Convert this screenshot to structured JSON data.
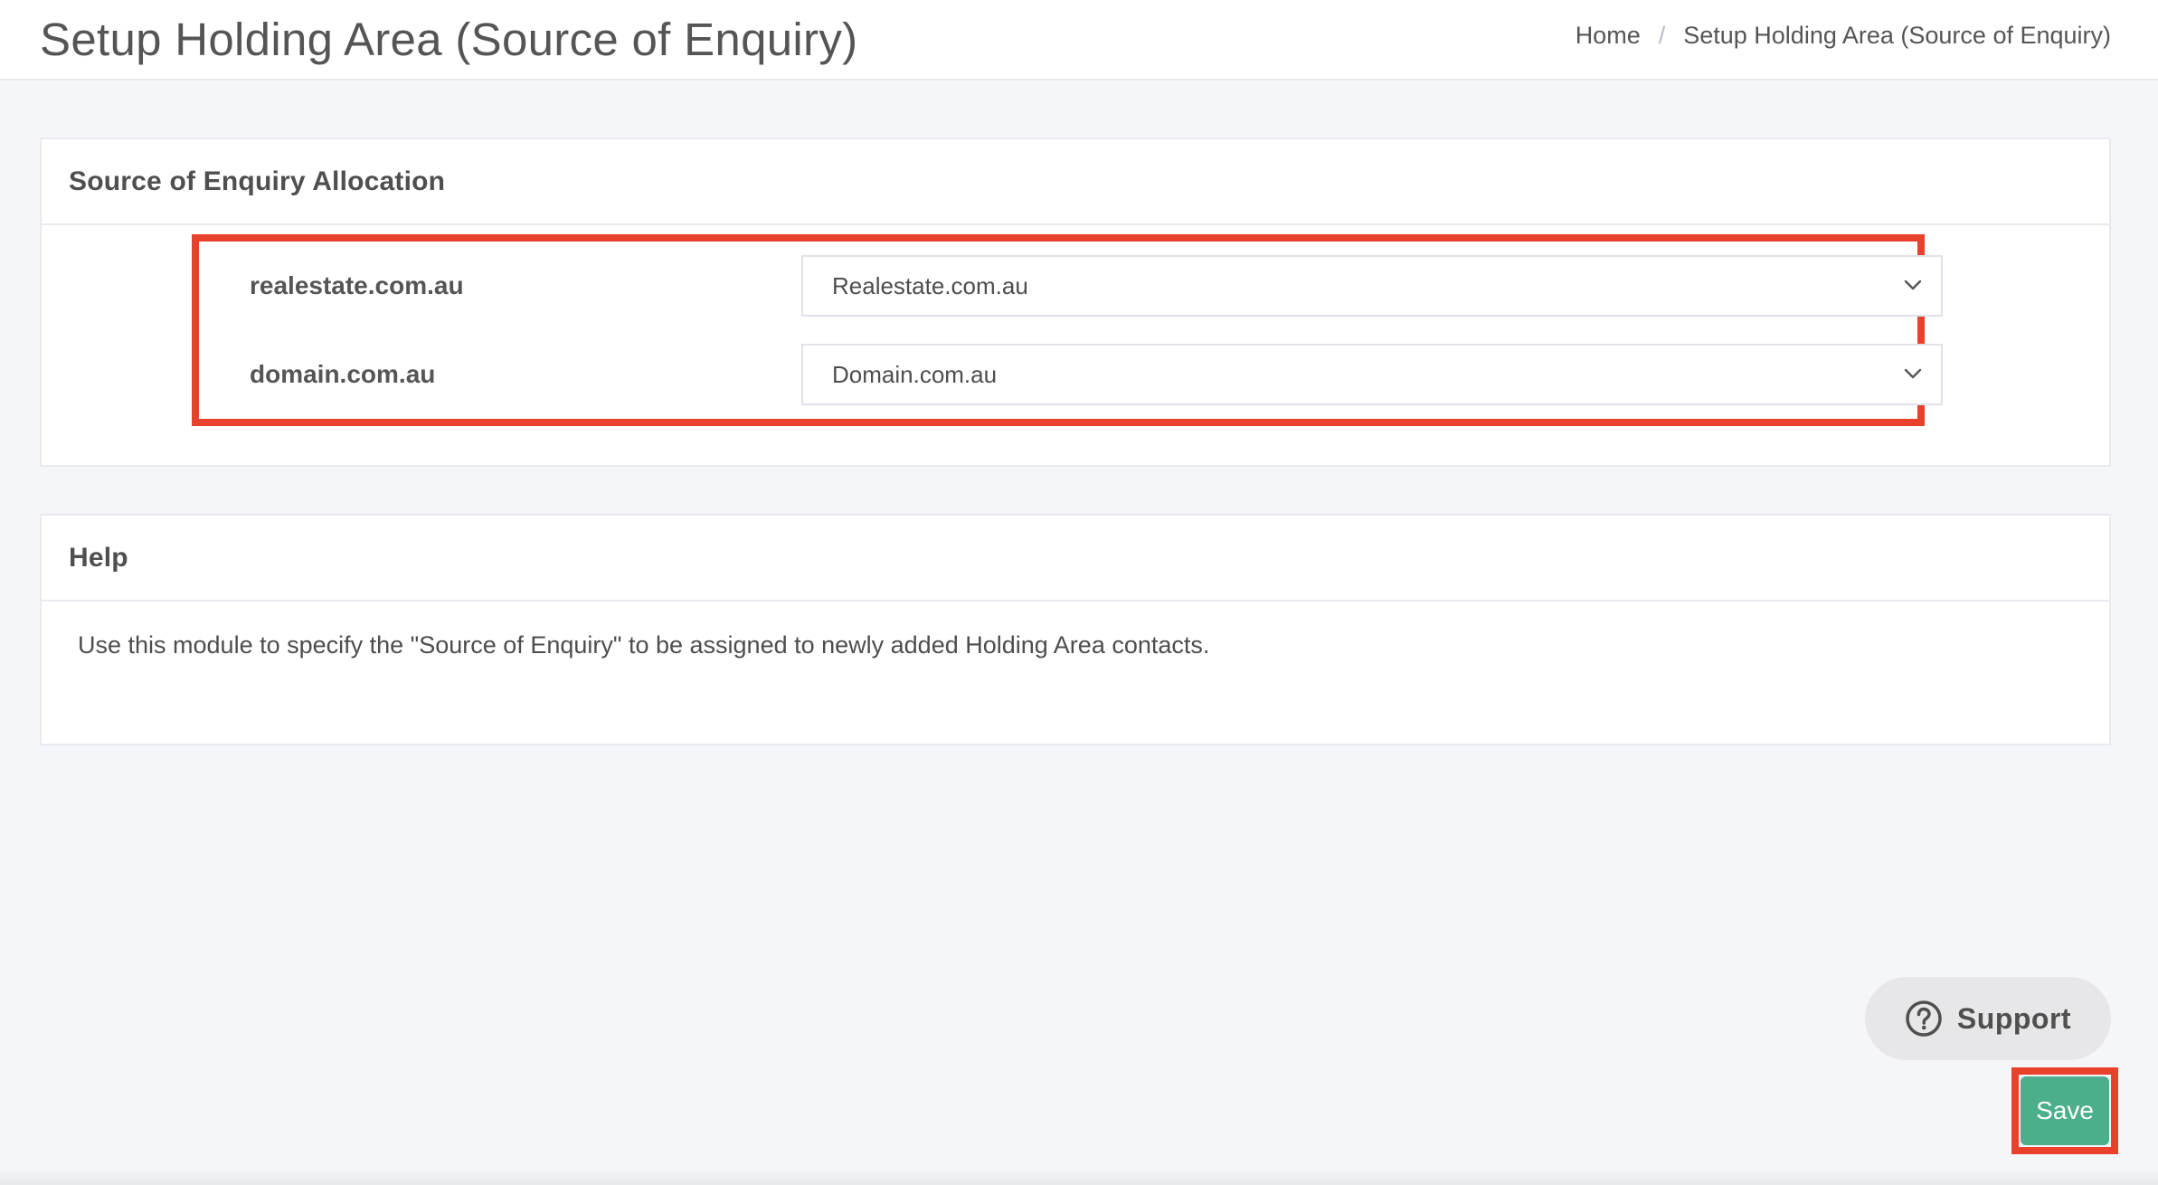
{
  "header": {
    "title": "Setup Holding Area (Source of Enquiry)",
    "breadcrumb": {
      "home": "Home",
      "separator": "/",
      "current": "Setup Holding Area (Source of Enquiry)"
    }
  },
  "allocation": {
    "title": "Source of Enquiry Allocation",
    "rows": [
      {
        "label": "realestate.com.au",
        "selected": "Realestate.com.au"
      },
      {
        "label": "domain.com.au",
        "selected": "Domain.com.au"
      }
    ]
  },
  "help": {
    "title": "Help",
    "text": "Use this module to specify the \"Source of Enquiry\" to be assigned to newly added Holding Area contacts."
  },
  "support": {
    "label": "Support",
    "icon": "question-circle-icon"
  },
  "actions": {
    "save_label": "Save"
  },
  "colors": {
    "accent": "#4caf8b",
    "highlight": "#e8412c",
    "background": "#f5f6f9"
  }
}
